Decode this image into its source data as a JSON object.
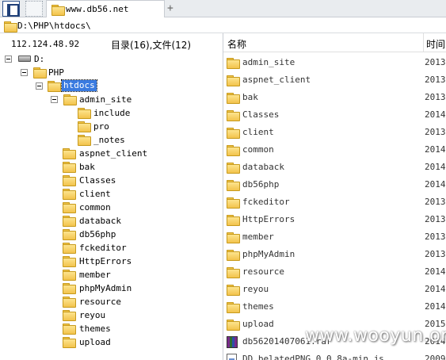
{
  "tab": {
    "title": "www.db56.net",
    "add": "+"
  },
  "address": {
    "path": "D:\\PHP\\htdocs\\"
  },
  "left_header": {
    "ip": "112.124.48.92",
    "counts": "目录(16),文件(12)"
  },
  "columns": {
    "name": "名称",
    "time": "时间"
  },
  "tree": {
    "drive": "D:",
    "php": "PHP",
    "htdocs": "htdocs",
    "admin_site": "admin_site",
    "admin_children": [
      "include",
      "pro",
      "_notes"
    ],
    "htdocs_children": [
      "aspnet_client",
      "bak",
      "Classes",
      "client",
      "common",
      "databack",
      "db56php",
      "fckeditor",
      "HttpErrors",
      "member",
      "phpMyAdmin",
      "resource",
      "reyou",
      "themes",
      "upload"
    ]
  },
  "files": [
    {
      "name": "admin_site",
      "time": "2013-"
    },
    {
      "name": "aspnet_client",
      "time": "2013-"
    },
    {
      "name": "bak",
      "time": "2013-"
    },
    {
      "name": "Classes",
      "time": "2014-"
    },
    {
      "name": "client",
      "time": "2013-"
    },
    {
      "name": "common",
      "time": "2014-"
    },
    {
      "name": "databack",
      "time": "2014-"
    },
    {
      "name": "db56php",
      "time": "2014-"
    },
    {
      "name": "fckeditor",
      "time": "2013-"
    },
    {
      "name": "HttpErrors",
      "time": "2013-"
    },
    {
      "name": "member",
      "time": "2013-"
    },
    {
      "name": "phpMyAdmin",
      "time": "2013-"
    },
    {
      "name": "resource",
      "time": "2014-"
    },
    {
      "name": "reyou",
      "time": "2014-"
    },
    {
      "name": "themes",
      "time": "2014-"
    },
    {
      "name": "upload",
      "time": "2015-"
    },
    {
      "name": "db56201407061.rar",
      "time": "2014-"
    },
    {
      "name": "DD_belatedPNG_0.0.8a-min.js",
      "time": "2009-"
    }
  ],
  "watermark": "www.wooyun.org"
}
